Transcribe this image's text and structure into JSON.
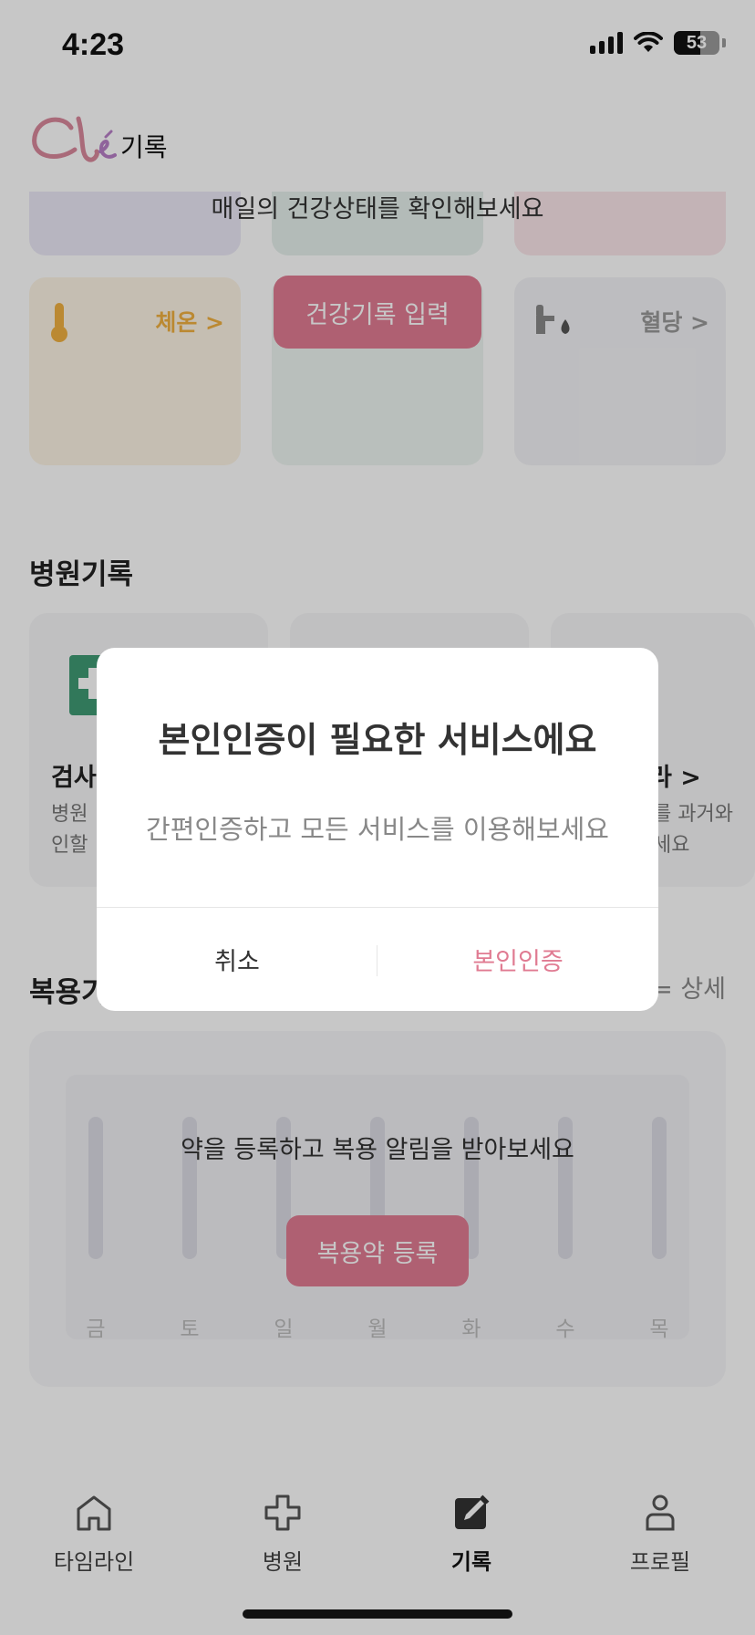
{
  "status_bar": {
    "time": "4:23",
    "battery": "53"
  },
  "header": {
    "logo_text": "Clé",
    "title": "기록"
  },
  "health": {
    "banner": "매일의 건강상태를 확인해보세요",
    "temperature_label": "체온 >",
    "blood_sugar_label": "혈당 >",
    "record_button": "건강기록 입력"
  },
  "hospital": {
    "section_title": "병원기록",
    "left_card_title": "검사",
    "left_card_desc_1": "병원",
    "left_card_desc_2": "인할",
    "right_card_title": "라 >",
    "right_card_desc_1": "를 과거와",
    "right_card_desc_2": "세요"
  },
  "medication": {
    "section_title": "복용기",
    "detail_link": "= 상세",
    "message": "약을 등록하고 복용 알림을 받아보세요",
    "register_button": "복용약 등록",
    "days": [
      "금",
      "토",
      "일",
      "월",
      "화",
      "수",
      "목"
    ]
  },
  "modal": {
    "title": "본인인증이 필요한 서비스에요",
    "subtitle": "간편인증하고 모든 서비스를 이용해보세요",
    "cancel": "취소",
    "confirm": "본인인증"
  },
  "tab_bar": {
    "tabs": [
      {
        "label": "타임라인",
        "icon": "home-icon"
      },
      {
        "label": "병원",
        "icon": "cross-icon"
      },
      {
        "label": "기록",
        "icon": "edit-icon",
        "active": true
      },
      {
        "label": "프로필",
        "icon": "person-icon"
      }
    ]
  },
  "colors": {
    "accent": "#e07b92",
    "temperature": "#f0b040",
    "overlay": "rgba(0,0,0,0.22)"
  }
}
